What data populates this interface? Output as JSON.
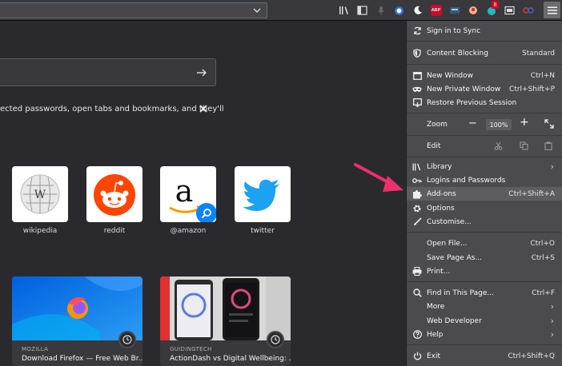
{
  "toolbar": {
    "urlbar_value": "",
    "icons": [
      "library-icon",
      "sidebar-icon",
      "microphone-icon",
      "container-icon",
      "moon-icon",
      "adblock-icon",
      "ext-icon",
      "ext-icon-2",
      "ext-badge-icon",
      "screenshot-icon",
      "glasses-icon"
    ],
    "adblock_label": "ABP",
    "badge_count": "8"
  },
  "newtab": {
    "notice_text": "ected passwords, open tabs and bookmarks, and they'll",
    "top_sites": [
      {
        "label": "wikipedia"
      },
      {
        "label": "reddit"
      },
      {
        "label": "@amazon"
      },
      {
        "label": "twitter"
      }
    ],
    "cards": [
      {
        "source": "MOZILLA",
        "title": "Download Firefox — Free Web Br..."
      },
      {
        "source": "GUIDINGTECH",
        "title": "ActionDash vs Digital Wellbeing: ..."
      }
    ]
  },
  "menu": {
    "sign_in": "Sign in to Sync",
    "content_blocking": "Content Blocking",
    "content_blocking_value": "Standard",
    "new_window": "New Window",
    "new_window_sc": "Ctrl+N",
    "new_private": "New Private Window",
    "new_private_sc": "Ctrl+Shift+P",
    "restore": "Restore Previous Session",
    "zoom": "Zoom",
    "zoom_value": "100%",
    "edit": "Edit",
    "library": "Library",
    "logins": "Logins and Passwords",
    "addons": "Add-ons",
    "addons_sc": "Ctrl+Shift+A",
    "options": "Options",
    "customise": "Customise...",
    "open_file": "Open File...",
    "open_file_sc": "Ctrl+O",
    "save_page": "Save Page As...",
    "save_page_sc": "Ctrl+S",
    "print": "Print...",
    "find": "Find in This Page...",
    "find_sc": "Ctrl+F",
    "more": "More",
    "web_dev": "Web Developer",
    "help": "Help",
    "exit": "Exit",
    "exit_sc": "Ctrl+Shift+Q"
  },
  "colors": {
    "accent_pointer": "#ee2f6e",
    "panel_bg": "#4a4a4f",
    "page_bg": "#2a2a2e"
  }
}
